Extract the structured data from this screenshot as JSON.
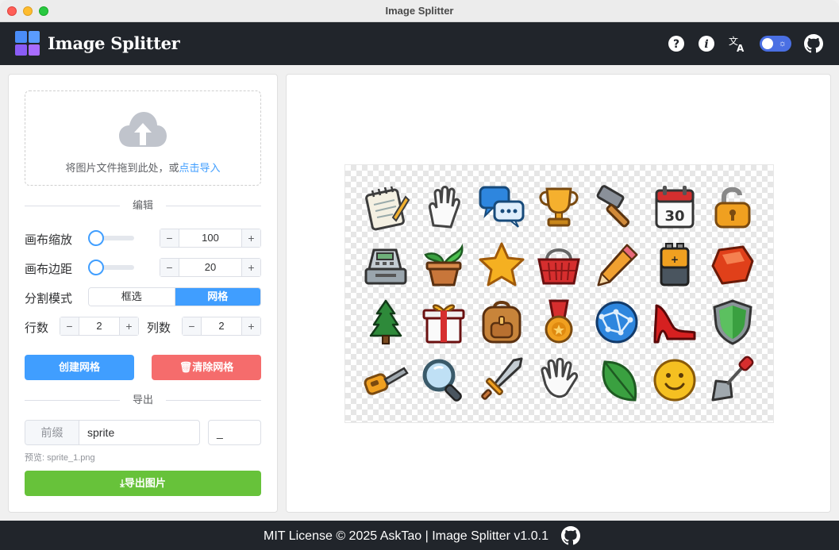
{
  "window": {
    "title": "Image Splitter"
  },
  "header": {
    "app_name": "Image Splitter",
    "icons": [
      "help-icon",
      "info-icon",
      "translate-icon",
      "theme-toggle",
      "github-icon"
    ]
  },
  "upload": {
    "hint": "将图片文件拖到此处，或",
    "link": "点击导入"
  },
  "edit": {
    "section_title": "编辑",
    "canvas_scale": {
      "label": "画布缩放",
      "slider_value": 100,
      "value": "100"
    },
    "canvas_margin": {
      "label": "画布边距",
      "slider_value": 20,
      "value": "20"
    },
    "split_mode": {
      "label": "分割模式",
      "options": [
        "框选",
        "网格"
      ],
      "selected": "网格"
    },
    "rows": {
      "label": "行数",
      "value": "2"
    },
    "cols": {
      "label": "列数",
      "value": "2"
    },
    "create_grid": "创建网格",
    "clear_grid": "清除网格"
  },
  "export": {
    "section_title": "导出",
    "prefix_label": "前缀",
    "prefix_value": "sprite",
    "separator_value": "_",
    "preview": "预览: sprite_1.png",
    "export_button": "导出图片"
  },
  "canvas": {
    "sprites": [
      [
        "notepad-icon",
        "glove-icon",
        "chat-bubbles-icon",
        "trophy-icon",
        "hammer-icon",
        "calendar-icon",
        "padlock-icon"
      ],
      [
        "cash-register-icon",
        "potted-plant-icon",
        "star-icon",
        "basket-icon",
        "pencil-icon",
        "battery-icon",
        "gem-icon"
      ],
      [
        "pine-tree-icon",
        "gift-icon",
        "backpack-icon",
        "medal-icon",
        "globe-icon",
        "high-heel-icon",
        "shield-icon"
      ],
      [
        "key-icon",
        "magnifier-icon",
        "sword-icon",
        "hand-icon",
        "leaf-icon",
        "smiley-icon",
        "trowel-icon"
      ]
    ],
    "calendar_day": "30"
  },
  "footer": {
    "text": "MIT License © 2025 AskTao | Image Splitter v1.0.1"
  },
  "colors": {
    "accent": "#409eff",
    "danger": "#f56c6c",
    "success": "#67c23a",
    "header_bg": "#21252b"
  }
}
